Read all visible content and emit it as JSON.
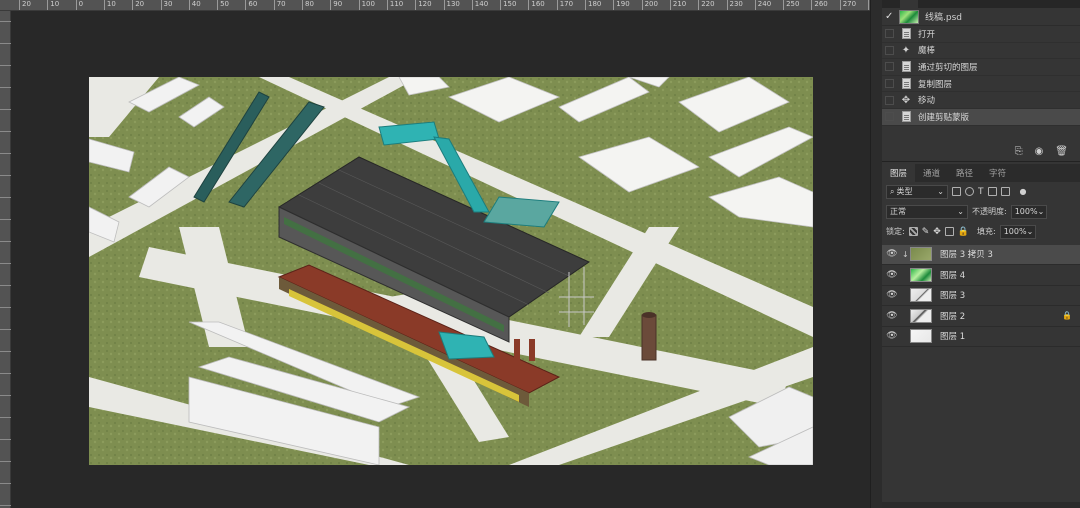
{
  "ruler": {
    "ticks": [
      "20",
      "10",
      "0",
      "10",
      "20",
      "30",
      "40",
      "50",
      "60",
      "70",
      "80",
      "90",
      "100",
      "110",
      "120",
      "130",
      "140",
      "150",
      "160",
      "170",
      "180",
      "190",
      "200",
      "210",
      "220",
      "230",
      "240",
      "250",
      "260",
      "270",
      "280"
    ]
  },
  "history": {
    "tabs": [
      " ",
      " "
    ],
    "snapshot_label": "线稿.psd",
    "items": [
      {
        "label": "打开",
        "icon": "document-icon"
      },
      {
        "label": "魔棒",
        "icon": "magic-wand-icon"
      },
      {
        "label": "通过剪切的图层",
        "icon": "document-icon"
      },
      {
        "label": "复制图层",
        "icon": "document-icon"
      },
      {
        "label": "移动",
        "icon": "move-icon"
      },
      {
        "label": "创建剪贴蒙版",
        "icon": "document-icon"
      }
    ]
  },
  "layers": {
    "tabs": [
      "图层",
      "通道",
      "路径",
      "字符"
    ],
    "filter_label": "类型",
    "blend_mode": "正常",
    "opacity_label": "不透明度:",
    "opacity_value": "100%",
    "lock_label": "锁定:",
    "fill_label": "填充:",
    "fill_value": "100%",
    "items": [
      {
        "name": "图层 3 拷贝 3",
        "active": true,
        "locked": false
      },
      {
        "name": "图层 4",
        "active": false,
        "locked": false
      },
      {
        "name": "图层 3",
        "active": false,
        "locked": false
      },
      {
        "name": "图层 2",
        "active": false,
        "locked": true
      },
      {
        "name": "图层 1",
        "active": false,
        "locked": false
      }
    ]
  },
  "colors": {
    "panel_bg": "#353535",
    "canvas_bg": "#282828",
    "grass": "#7f8f52",
    "roof_dark": "#3c3c3c",
    "roof_red": "#8a3a28",
    "accent_teal": "#2fb3b3"
  }
}
